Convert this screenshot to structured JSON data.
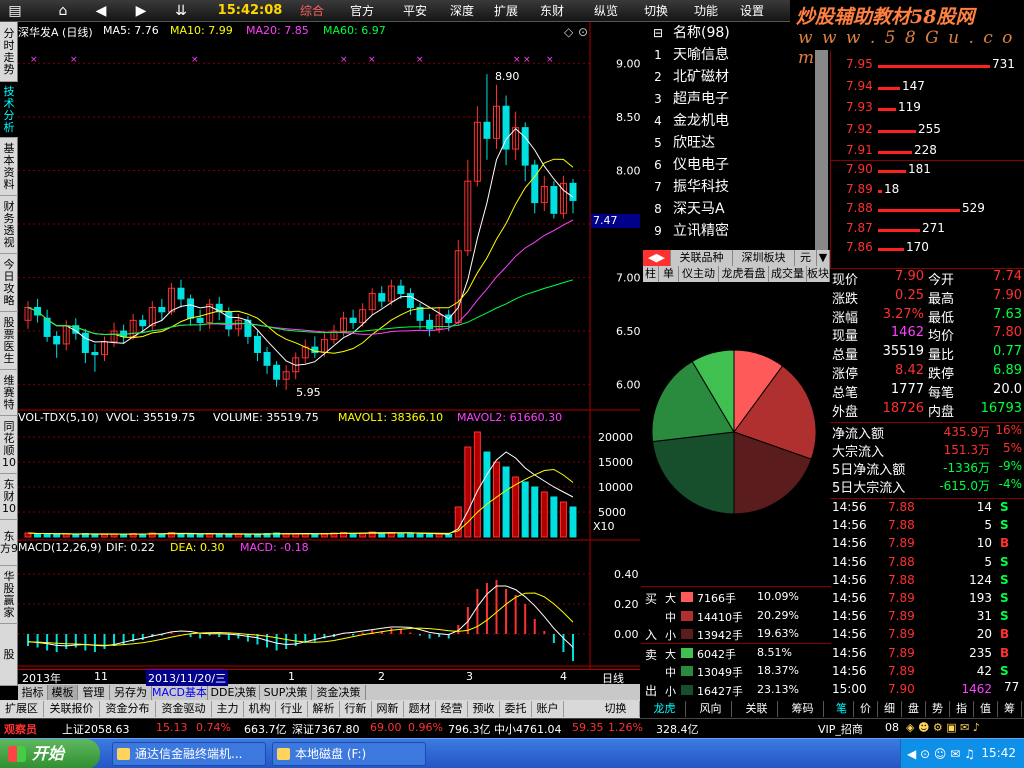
{
  "toolbar": {
    "time": "15:42:08",
    "menu": [
      "综合",
      "官方",
      "平安",
      "深度",
      "扩展",
      "东财",
      "纵览",
      "切换",
      "功能",
      "设置"
    ],
    "brand": "炒股辅助教材58股网",
    "brand_url": "w w w . 5 8 G u . c o m"
  },
  "left_tabs": [
    "分时走势",
    "技术分析",
    "基本资料",
    "财务透视",
    "今日攻略",
    "股票医生",
    "维赛特",
    "同花顺10",
    "东财10",
    "东方9",
    "华股赢家",
    "股"
  ],
  "header": {
    "stock": "深华发A (日线)",
    "ma5": "MA5: 7.76",
    "ma10": "MA10: 7.99",
    "ma20": "MA20: 7.85",
    "ma60": "MA60: 6.97"
  },
  "volume_header": {
    "ind": "VOL-TDX(5,10)",
    "vvol": "VVOL: 35519.75",
    "volume": "VOLUME: 35519.75",
    "mavol1": "MAVOL1: 38366.10",
    "mavol2": "MAVOL2: 61660.30"
  },
  "macd_header": {
    "ind": "MACD(12,26,9)",
    "dif": "DIF: 0.22",
    "dea": "DEA: 0.30",
    "macd": "MACD: -0.18"
  },
  "chart_data": {
    "type": "candlestick",
    "price_axis": [
      "9.00",
      "8.50",
      "8.00",
      "7.50",
      "7.00",
      "6.50",
      "6.00"
    ],
    "price_range": [
      5.8,
      9.2
    ],
    "annotations": {
      "high": "8.90",
      "low": "5.95",
      "current": "7.47"
    },
    "volume_axis": [
      "20000",
      "15000",
      "10000",
      "5000"
    ],
    "volume_multiplier": "X10",
    "macd_axis": [
      "0.40",
      "0.20",
      "0.00"
    ],
    "x_labels": [
      "2013年",
      "11",
      "2013/11/20/三",
      "1",
      "2",
      "3",
      "4"
    ],
    "period": "日线",
    "candles": [
      [
        6.6,
        6.72,
        6.78,
        6.52
      ],
      [
        6.72,
        6.65,
        6.8,
        6.58
      ],
      [
        6.62,
        6.45,
        6.7,
        6.4
      ],
      [
        6.45,
        6.38,
        6.5,
        6.25
      ],
      [
        6.38,
        6.55,
        6.6,
        6.32
      ],
      [
        6.55,
        6.48,
        6.62,
        6.42
      ],
      [
        6.48,
        6.3,
        6.52,
        6.2
      ],
      [
        6.3,
        6.28,
        6.38,
        6.12
      ],
      [
        6.28,
        6.4,
        6.45,
        6.22
      ],
      [
        6.4,
        6.5,
        6.58,
        6.35
      ],
      [
        6.5,
        6.45,
        6.56,
        6.38
      ],
      [
        6.45,
        6.6,
        6.66,
        6.42
      ],
      [
        6.6,
        6.55,
        6.65,
        6.48
      ],
      [
        6.55,
        6.72,
        6.78,
        6.5
      ],
      [
        6.72,
        6.68,
        6.8,
        6.6
      ],
      [
        6.68,
        6.9,
        6.95,
        6.65
      ],
      [
        6.9,
        6.8,
        6.98,
        6.72
      ],
      [
        6.8,
        6.62,
        6.84,
        6.55
      ],
      [
        6.62,
        6.58,
        6.7,
        6.5
      ],
      [
        6.58,
        6.75,
        6.8,
        6.52
      ],
      [
        6.75,
        6.68,
        6.82,
        6.6
      ],
      [
        6.68,
        6.52,
        6.72,
        6.45
      ],
      [
        6.52,
        6.6,
        6.66,
        6.45
      ],
      [
        6.6,
        6.45,
        6.64,
        6.38
      ],
      [
        6.45,
        6.3,
        6.5,
        6.22
      ],
      [
        6.3,
        6.18,
        6.35,
        6.1
      ],
      [
        6.18,
        6.05,
        6.22,
        5.98
      ],
      [
        6.05,
        6.12,
        6.18,
        5.95
      ],
      [
        6.12,
        6.25,
        6.3,
        6.05
      ],
      [
        6.25,
        6.35,
        6.42,
        6.2
      ],
      [
        6.35,
        6.3,
        6.45,
        6.25
      ],
      [
        6.3,
        6.42,
        6.48,
        6.26
      ],
      [
        6.42,
        6.5,
        6.56,
        6.38
      ],
      [
        6.5,
        6.62,
        6.68,
        6.45
      ],
      [
        6.62,
        6.58,
        6.7,
        6.52
      ],
      [
        6.58,
        6.7,
        6.76,
        6.54
      ],
      [
        6.7,
        6.85,
        6.9,
        6.65
      ],
      [
        6.85,
        6.78,
        6.92,
        6.72
      ],
      [
        6.78,
        6.92,
        6.98,
        6.74
      ],
      [
        6.92,
        6.85,
        6.98,
        6.8
      ],
      [
        6.85,
        6.72,
        6.9,
        6.65
      ],
      [
        6.72,
        6.6,
        6.76,
        6.52
      ],
      [
        6.6,
        6.52,
        6.66,
        6.45
      ],
      [
        6.52,
        6.65,
        6.72,
        6.48
      ],
      [
        6.65,
        6.58,
        6.7,
        6.5
      ],
      [
        6.58,
        7.25,
        7.35,
        6.55
      ],
      [
        7.25,
        7.9,
        8.1,
        7.2
      ],
      [
        7.9,
        8.45,
        8.6,
        7.85
      ],
      [
        8.45,
        8.3,
        8.9,
        8.1
      ],
      [
        8.3,
        8.6,
        8.8,
        8.2
      ],
      [
        8.6,
        8.2,
        8.7,
        8.05
      ],
      [
        8.2,
        8.4,
        8.55,
        8.1
      ],
      [
        8.4,
        8.05,
        8.45,
        7.9
      ],
      [
        8.05,
        7.7,
        8.1,
        7.6
      ],
      [
        7.7,
        7.85,
        7.95,
        7.62
      ],
      [
        7.85,
        7.6,
        7.9,
        7.55
      ],
      [
        7.6,
        7.88,
        7.95,
        7.55
      ],
      [
        7.88,
        7.72,
        7.92,
        7.6
      ]
    ],
    "volumes": [
      8,
      6,
      7,
      5,
      6,
      5,
      7,
      6,
      5,
      6,
      5,
      7,
      6,
      8,
      6,
      9,
      7,
      6,
      5,
      7,
      6,
      5,
      6,
      5,
      6,
      7,
      8,
      7,
      6,
      7,
      6,
      7,
      8,
      9,
      7,
      8,
      10,
      8,
      9,
      8,
      7,
      6,
      5,
      6,
      5,
      60,
      180,
      210,
      170,
      150,
      140,
      120,
      110,
      100,
      90,
      80,
      70,
      60
    ],
    "macd": [
      -0.08,
      -0.09,
      -0.11,
      -0.12,
      -0.1,
      -0.09,
      -0.11,
      -0.12,
      -0.1,
      -0.08,
      -0.07,
      -0.05,
      -0.04,
      -0.02,
      -0.01,
      0.01,
      0.0,
      -0.02,
      -0.03,
      -0.01,
      -0.02,
      -0.04,
      -0.03,
      -0.05,
      -0.07,
      -0.09,
      -0.11,
      -0.1,
      -0.08,
      -0.06,
      -0.05,
      -0.03,
      -0.02,
      0.0,
      -0.01,
      0.01,
      0.03,
      0.02,
      0.04,
      0.03,
      0.01,
      -0.01,
      -0.03,
      -0.02,
      -0.03,
      0.06,
      0.18,
      0.3,
      0.34,
      0.36,
      0.3,
      0.26,
      0.2,
      0.1,
      0.02,
      -0.06,
      -0.12,
      -0.18
    ]
  },
  "stock_list": {
    "title": "名称(98)",
    "items": [
      {
        "n": "1",
        "name": "天喻信息"
      },
      {
        "n": "2",
        "name": "北矿磁材"
      },
      {
        "n": "3",
        "name": "超声电子"
      },
      {
        "n": "4",
        "name": "金龙机电"
      },
      {
        "n": "5",
        "name": "欣旺达"
      },
      {
        "n": "6",
        "name": "仪电电子"
      },
      {
        "n": "7",
        "name": "振华科技"
      },
      {
        "n": "8",
        "name": "深天马A"
      },
      {
        "n": "9",
        "name": "立讯精密"
      }
    ],
    "subtabs": [
      "关联品种",
      "深圳板块",
      "元"
    ],
    "tabs2": [
      "柱",
      "单",
      "仪主动",
      "龙虎看盘",
      "成交量",
      "板块"
    ]
  },
  "pie": {
    "slices": [
      {
        "value": 10.09,
        "color": "#ff5a5a"
      },
      {
        "value": 20.29,
        "color": "#b03030"
      },
      {
        "value": 19.63,
        "color": "#5a1c1c"
      },
      {
        "value": 23.13,
        "color": "#174f2c"
      },
      {
        "value": 18.37,
        "color": "#2a8a3e"
      },
      {
        "value": 8.51,
        "color": "#40c050"
      }
    ]
  },
  "flow": {
    "buy_label": [
      "买",
      "入"
    ],
    "sell_label": [
      "卖",
      "出"
    ],
    "rows": [
      {
        "s": "大",
        "v": "7166手",
        "p": "10.09%",
        "c": "#ff5a5a"
      },
      {
        "s": "中",
        "v": "14410手",
        "p": "20.29%",
        "c": "#b03030"
      },
      {
        "s": "小",
        "v": "13942手",
        "p": "19.63%",
        "c": "#5a1c1c"
      },
      {
        "s": "大",
        "v": "6042手",
        "p": "8.51%",
        "c": "#40c050"
      },
      {
        "s": "中",
        "v": "13049手",
        "p": "18.37%",
        "c": "#2a8a3e"
      },
      {
        "s": "小",
        "v": "16427手",
        "p": "23.13%",
        "c": "#174f2c"
      }
    ]
  },
  "order_book": {
    "sell": [
      {
        "p": "7.95",
        "v": "731",
        "w": 112
      },
      {
        "p": "7.94",
        "v": "147",
        "w": 22
      },
      {
        "p": "7.93",
        "v": "119",
        "w": 18
      },
      {
        "p": "7.92",
        "v": "255",
        "w": 38
      },
      {
        "p": "7.91",
        "v": "228",
        "w": 34
      }
    ],
    "buy": [
      {
        "p": "7.90",
        "v": "181",
        "w": 28
      },
      {
        "p": "7.89",
        "v": "18",
        "w": 4
      },
      {
        "p": "7.88",
        "v": "529",
        "w": 82
      },
      {
        "p": "7.87",
        "v": "271",
        "w": 42
      },
      {
        "p": "7.86",
        "v": "170",
        "w": 26
      }
    ]
  },
  "quote": [
    {
      "l": "现价",
      "v": "7.90",
      "vc": "#ff3030",
      "l2": "今开",
      "v2": "7.74",
      "v2c": "#ff3030"
    },
    {
      "l": "涨跌",
      "v": "0.25",
      "vc": "#ff3030",
      "l2": "最高",
      "v2": "7.90",
      "v2c": "#ff3030"
    },
    {
      "l": "涨幅",
      "v": "3.27%",
      "vc": "#ff3030",
      "l2": "最低",
      "v2": "7.63",
      "v2c": "#00ff40"
    },
    {
      "l": "现量",
      "v": "1462",
      "vc": "#ff40ff",
      "l2": "均价",
      "v2": "7.80",
      "v2c": "#ff3030"
    },
    {
      "l": "总量",
      "v": "35519",
      "vc": "#fff",
      "l2": "量比",
      "v2": "0.77",
      "v2c": "#00ff40"
    },
    {
      "l": "涨停",
      "v": "8.42",
      "vc": "#ff3030",
      "l2": "跌停",
      "v2": "6.89",
      "v2c": "#00ff40"
    },
    {
      "l": "总笔",
      "v": "1777",
      "vc": "#fff",
      "l2": "每笔",
      "v2": "20.0",
      "v2c": "#fff"
    },
    {
      "l": "外盘",
      "v": "18726",
      "vc": "#ff3030",
      "l2": "内盘",
      "v2": "16793",
      "v2c": "#00ff40"
    }
  ],
  "fundflow": [
    {
      "l": "净流入额",
      "v": "435.9万",
      "p": "16%",
      "c": "#ff3030"
    },
    {
      "l": "大宗流入",
      "v": "151.3万",
      "p": "5%",
      "c": "#ff3030"
    },
    {
      "l": "5日净流入额",
      "v": "-1336万",
      "p": "-9%",
      "c": "#00ff40"
    },
    {
      "l": "5日大宗流入",
      "v": "-615.0万",
      "p": "-4%",
      "c": "#00ff40"
    }
  ],
  "ticks": [
    {
      "t": "14:56",
      "p": "7.88",
      "v": "14",
      "f": "S",
      "fc": "#00ff40"
    },
    {
      "t": "14:56",
      "p": "7.88",
      "v": "5",
      "f": "S",
      "fc": "#00ff40"
    },
    {
      "t": "14:56",
      "p": "7.89",
      "v": "10",
      "f": "B",
      "fc": "#ff3030"
    },
    {
      "t": "14:56",
      "p": "7.88",
      "v": "5",
      "f": "S",
      "fc": "#00ff40"
    },
    {
      "t": "14:56",
      "p": "7.88",
      "v": "124",
      "f": "S",
      "fc": "#00ff40"
    },
    {
      "t": "14:56",
      "p": "7.89",
      "v": "193",
      "f": "S",
      "fc": "#00ff40"
    },
    {
      "t": "14:56",
      "p": "7.89",
      "v": "31",
      "f": "S",
      "fc": "#00ff40"
    },
    {
      "t": "14:56",
      "p": "7.89",
      "v": "20",
      "f": "B",
      "fc": "#ff3030"
    },
    {
      "t": "14:56",
      "p": "7.89",
      "v": "235",
      "f": "B",
      "fc": "#ff3030"
    },
    {
      "t": "14:56",
      "p": "7.89",
      "v": "42",
      "f": "S",
      "fc": "#00ff40"
    },
    {
      "t": "15:00",
      "p": "7.90",
      "v": "1462",
      "f": "",
      "fc": "#fff"
    }
  ],
  "bottom_tabs": [
    "指标",
    "模板",
    "管理",
    "另存为",
    "MACD基本",
    "DDE决策",
    "SUP决策",
    "资金决策"
  ],
  "bottom_tabs2": [
    "扩展区",
    "关联报价",
    "资金分布",
    "资金驱动",
    "主力",
    "机构",
    "行业",
    "解析",
    "行新",
    "网新",
    "题材",
    "经营",
    "预收",
    "委托",
    "账户",
    "切换"
  ],
  "right_tabs": [
    "龙虎",
    "风向",
    "关联",
    "筹码"
  ],
  "right_tabs2": [
    "笔",
    "价",
    "细",
    "盘",
    "势",
    "指",
    "值",
    "筹"
  ],
  "status": {
    "warn": "观察员",
    "sh": "上证2058.63",
    "sh_chg": "15.13",
    "sh_pct": "0.74%",
    "sh_amt": "663.7亿",
    "sz": "深证7367.80",
    "sz_chg": "69.00",
    "sz_pct": "0.96%",
    "sz_amt": "796.3亿",
    "zx": "中小4761.04",
    "zx_chg": "59.35",
    "zx_pct": "1.26%",
    "zx_amt": "328.4亿",
    "vip": "VIP_招商",
    "code": "08"
  },
  "taskbar": {
    "start": "开始",
    "tasks": [
      "通达信金融终端机...",
      "本地磁盘 (F:)"
    ],
    "clock": "15:42"
  }
}
